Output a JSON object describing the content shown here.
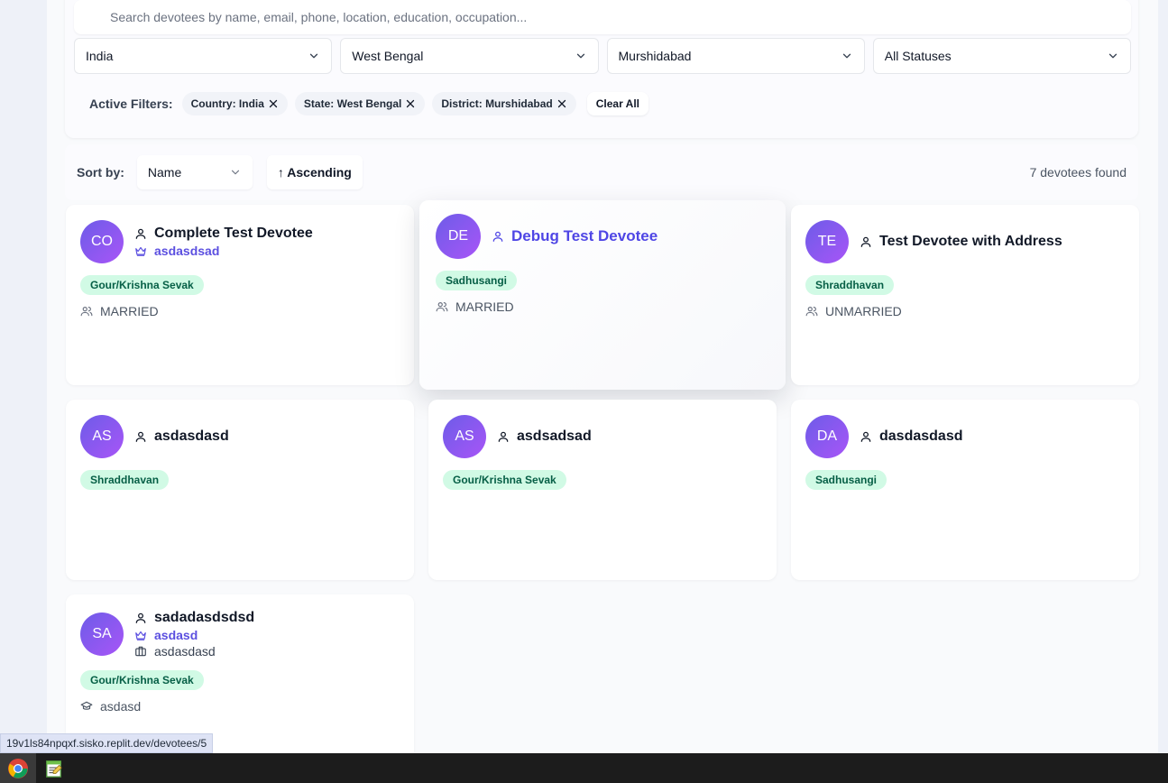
{
  "search": {
    "placeholder": "Search devotees by name, email, phone, location, education, occupation..."
  },
  "filters": {
    "country": "India",
    "state": "West Bengal",
    "district": "Murshidabad",
    "status": "All Statuses"
  },
  "active_filters": {
    "label": "Active Filters:",
    "chips": [
      "Country: India",
      "State: West Bengal",
      "District: Murshidabad"
    ],
    "clear_label": "Clear All"
  },
  "sort": {
    "label": "Sort by:",
    "field": "Name",
    "order_label": "↑ Ascending",
    "results_text": "7 devotees found"
  },
  "devotees": [
    {
      "initials": "CO",
      "name": "Complete Test Devotee",
      "spiritual_name": "asdasdsad",
      "status": "Gour/Krishna Sevak",
      "marital": "MARRIED"
    },
    {
      "initials": "DE",
      "name": "Debug Test Devotee",
      "status": "Sadhusangi",
      "marital": "MARRIED"
    },
    {
      "initials": "TE",
      "name": "Test Devotee with Address",
      "status": "Shraddhavan",
      "marital": "UNMARRIED"
    },
    {
      "initials": "AS",
      "name": "asdasdasd",
      "status": "Shraddhavan"
    },
    {
      "initials": "AS",
      "name": "asdsadsad",
      "status": "Gour/Krishna Sevak"
    },
    {
      "initials": "DA",
      "name": "dasdasdasd",
      "status": "Sadhusangi"
    },
    {
      "initials": "SA",
      "name": "sadadasdsdsd",
      "spiritual_name": "asdasd",
      "occupation": "asdasdasd",
      "status": "Gour/Krishna Sevak",
      "education": "asdasd"
    }
  ],
  "status_bar": {
    "url": "19v1ls84npqxf.sisko.replit.dev/devotees/5"
  },
  "taskbar": {
    "apps": [
      "chrome-icon",
      "notepad-icon"
    ]
  }
}
